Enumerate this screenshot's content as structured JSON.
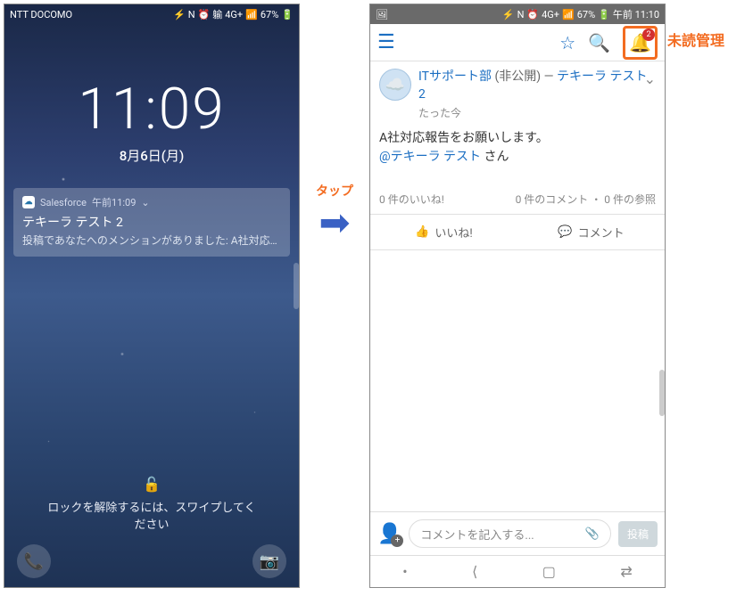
{
  "annotations": {
    "tap_label": "タップ",
    "unread_label": "未読管理"
  },
  "phone1": {
    "status": {
      "carrier": "NTT DOCOMO",
      "battery": "67%"
    },
    "clock": "11:09",
    "date": "8月6日(月)",
    "notification": {
      "app": "Salesforce",
      "time": "午前11:09",
      "title": "テキーラ テスト 2",
      "body": "投稿であなたへのメンションがありました: A社対応報..."
    },
    "lock_hint_line1": "ロックを解除するには、スワイプしてく",
    "lock_hint_line2": "ださい"
  },
  "phone2": {
    "status": {
      "battery": "67%",
      "time": "午前 11:10"
    },
    "bell_badge": "2",
    "feed": {
      "author_prefix": "ITサポート部",
      "visibility": "(非公開)",
      "dash": "—",
      "author_suffix": "テキーラ テスト 2",
      "time": "たった今",
      "body_line1": "A社対応報告をお願いします。",
      "mention": "@テキーラ テスト",
      "mention_suffix": "さん",
      "stats_like": "0 件のいいね!",
      "stats_comment": "0 件のコメント",
      "stats_ref": "0 件の参照"
    },
    "actions": {
      "like": "いいね!",
      "comment": "コメント"
    },
    "input": {
      "placeholder": "コメントを記入する...",
      "post": "投稿"
    }
  }
}
